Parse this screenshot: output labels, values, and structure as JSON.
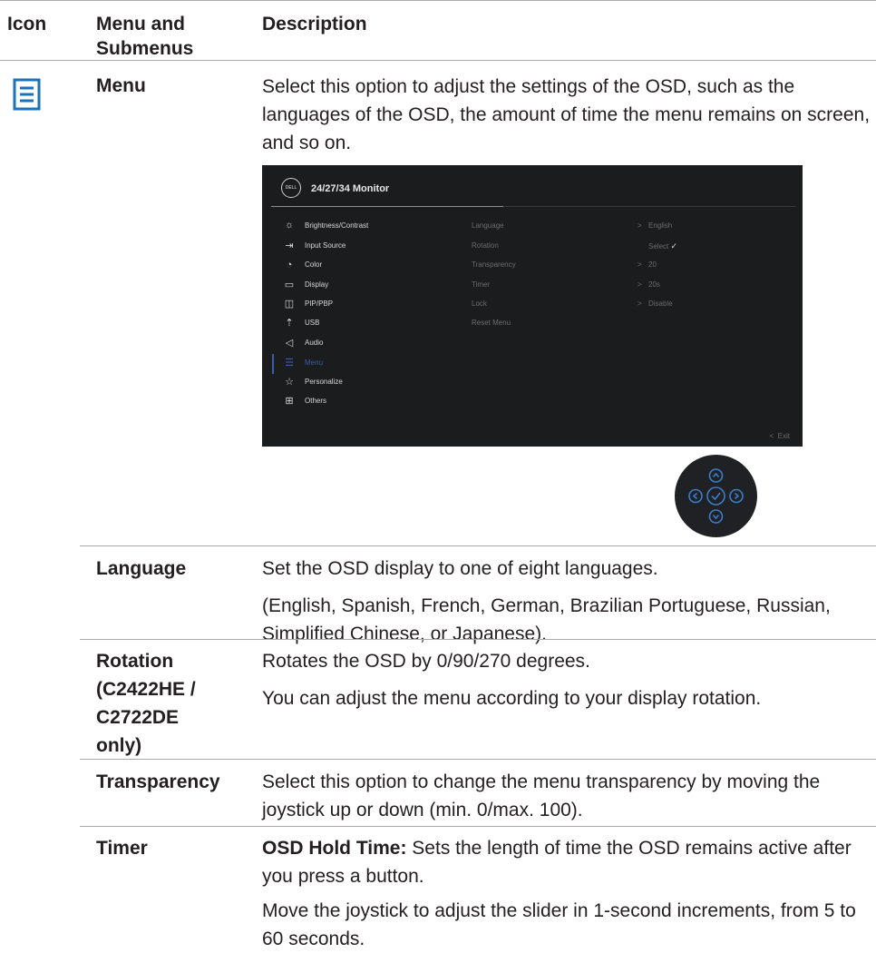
{
  "header": {
    "icon": "Icon",
    "menu": "Menu and",
    "menu2": "Submenus",
    "description": "Description"
  },
  "menu_row": {
    "icon": "menu-list-icon",
    "label": "Menu",
    "description": "Select this option to adjust the settings of the OSD, such as the languages of the OSD, the amount of time the menu remains on screen, and so on."
  },
  "osd": {
    "brand": "DELL",
    "title": "24/27/34 Monitor",
    "items": [
      "Brightness/Contrast",
      "Input Source",
      "Color",
      "Display",
      "PIP/PBP",
      "USB",
      "Audio",
      "Menu",
      "Personalize",
      "Others"
    ],
    "sub_items": [
      "Language",
      "Rotation",
      "Transparency",
      "Timer",
      "Lock",
      "Reset Menu"
    ],
    "values": [
      "English",
      "Select",
      "20",
      "20s",
      "Disable"
    ],
    "exit": "Exit",
    "accent": "#3a5fa8"
  },
  "rows": [
    {
      "label": "Language",
      "desc1": "Set the OSD display to one of eight languages.",
      "desc2": "(English, Spanish, French, German, Brazilian Portuguese, Russian, Simplified Chinese, or Japanese)."
    },
    {
      "label1": "Rotation",
      "label2": "(C2422HE /",
      "label3": "C2722DE",
      "label4": "only)",
      "desc1": "Rotates the OSD by 0/90/270 degrees.",
      "desc2": "You can adjust the menu according to your display rotation."
    },
    {
      "label": "Transparency",
      "desc1": "Select this option to change the menu transparency by moving the joystick up or down (min. 0/max. 100)."
    },
    {
      "label": "Timer",
      "desc1_bold": "OSD Hold Time:",
      "desc1_rest": " Sets the length of time the OSD remains active after you press a button.",
      "desc2": "Move the joystick to adjust the slider in 1-second increments, from 5 to 60 seconds."
    }
  ]
}
